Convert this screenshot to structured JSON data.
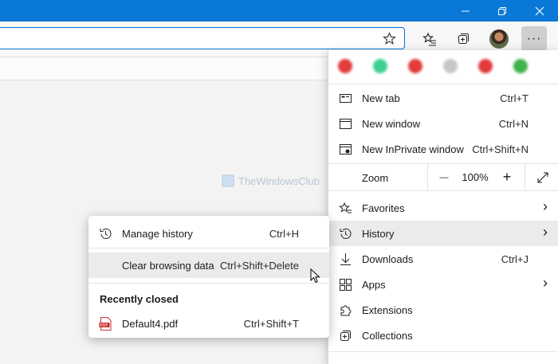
{
  "window": {
    "controls": [
      "minimize-icon",
      "restore-icon",
      "close-icon"
    ],
    "titlebar_color": "#0a78d7"
  },
  "toolbar": {
    "icons": [
      "favorite-star-icon",
      "favorites-icon",
      "collections-icon",
      "profile-avatar",
      "more-icon"
    ],
    "more_label": "···"
  },
  "watermark": {
    "text": "TheWindowsClub"
  },
  "menu": {
    "extension_colors": [
      "#e23b3b",
      "#3fcf93",
      "#e23b3b",
      "#c7c7c7",
      "#e23b3b",
      "#3fb24a"
    ],
    "items_top": [
      {
        "label": "New tab",
        "shortcut": "Ctrl+T",
        "icon": "new-tab-icon"
      },
      {
        "label": "New window",
        "shortcut": "Ctrl+N",
        "icon": "new-window-icon"
      },
      {
        "label": "New InPrivate window",
        "shortcut": "Ctrl+Shift+N",
        "icon": "inprivate-icon"
      }
    ],
    "zoom": {
      "label": "Zoom",
      "minus": "—",
      "value": "100%",
      "plus": "+"
    },
    "items_bottom": [
      {
        "label": "Favorites",
        "shortcut": "",
        "icon": "favorites-icon",
        "chevron": "›"
      },
      {
        "label": "History",
        "shortcut": "",
        "icon": "history-icon",
        "chevron": "›"
      },
      {
        "label": "Downloads",
        "shortcut": "Ctrl+J",
        "icon": "download-icon",
        "chevron": ""
      },
      {
        "label": "Apps",
        "shortcut": "",
        "icon": "apps-icon",
        "chevron": "›"
      },
      {
        "label": "Extensions",
        "shortcut": "",
        "icon": "extensions-icon",
        "chevron": ""
      },
      {
        "label": "Collections",
        "shortcut": "",
        "icon": "collections-icon",
        "chevron": ""
      }
    ]
  },
  "history_submenu": {
    "manage": {
      "label": "Manage history",
      "shortcut": "Ctrl+H"
    },
    "clear": {
      "label": "Clear browsing data",
      "shortcut": "Ctrl+Shift+Delete"
    },
    "recent_heading": "Recently closed",
    "recent": [
      {
        "label": "Default4.pdf",
        "shortcut": "Ctrl+Shift+T",
        "badge": "PDF"
      }
    ]
  }
}
